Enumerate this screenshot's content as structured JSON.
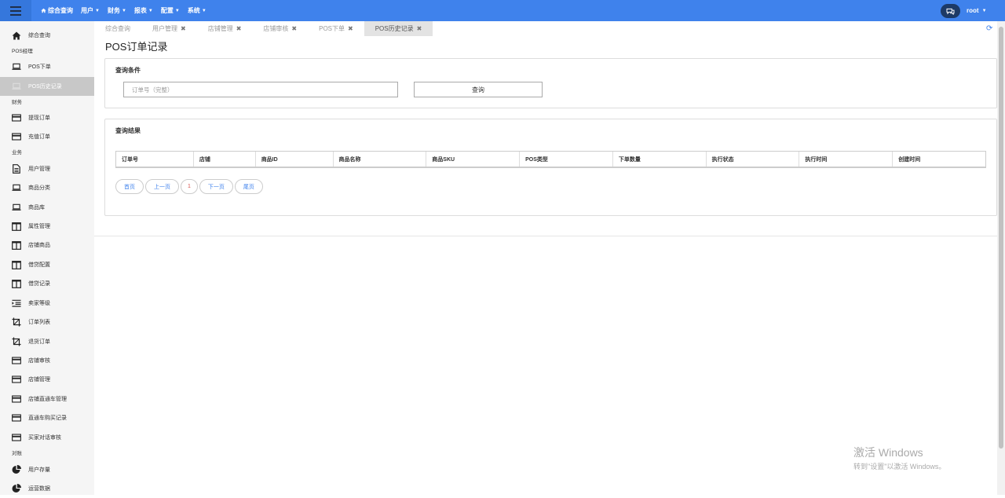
{
  "topbar": {
    "nav": [
      {
        "label": "综合查询",
        "icon": "home-icon"
      },
      {
        "label": "用户",
        "caret": true
      },
      {
        "label": "财务",
        "caret": true
      },
      {
        "label": "报表",
        "caret": true
      },
      {
        "label": "配置",
        "caret": true
      },
      {
        "label": "系统",
        "caret": true
      }
    ],
    "user": "root",
    "accent_color": "#3f82ec"
  },
  "sidebar": {
    "items": [
      {
        "label": "综合查询",
        "icon": "home-icon"
      },
      {
        "label": "POS下单",
        "icon": "laptop-icon"
      },
      {
        "label": "POS历史记录",
        "icon": "laptop-icon",
        "active": true
      },
      {
        "label": "提现订单",
        "icon": "credit-card-icon"
      },
      {
        "label": "充值订单",
        "icon": "credit-card-icon"
      },
      {
        "label": "用户管理",
        "icon": "file-text-icon"
      },
      {
        "label": "商品分类",
        "icon": "laptop-icon"
      },
      {
        "label": "商品库",
        "icon": "laptop-icon"
      },
      {
        "label": "属性管理",
        "icon": "columns-icon"
      },
      {
        "label": "店铺商品",
        "icon": "columns-icon"
      },
      {
        "label": "借贷配置",
        "icon": "columns-icon"
      },
      {
        "label": "借贷记录",
        "icon": "columns-icon"
      },
      {
        "label": "卖家等级",
        "icon": "indent-icon"
      },
      {
        "label": "订单列表",
        "icon": "crop-icon"
      },
      {
        "label": "退货订单",
        "icon": "crop-icon"
      },
      {
        "label": "店铺审核",
        "icon": "credit-card-icon"
      },
      {
        "label": "店铺管理",
        "icon": "credit-card-icon"
      },
      {
        "label": "店铺直通车管理",
        "icon": "credit-card-icon"
      },
      {
        "label": "直通车购买记录",
        "icon": "credit-card-icon"
      },
      {
        "label": "买家对话审核",
        "icon": "credit-card-icon"
      },
      {
        "label": "用户存量",
        "icon": "pie-chart-icon"
      },
      {
        "label": "运营数据",
        "icon": "pie-chart-icon"
      }
    ],
    "sections": [
      "POS经理",
      "财务",
      "业务",
      "对账"
    ]
  },
  "tabs": [
    {
      "label": "综合查询",
      "closable": false
    },
    {
      "label": "用户管理",
      "closable": true
    },
    {
      "label": "店铺管理",
      "closable": true
    },
    {
      "label": "店铺审核",
      "closable": true
    },
    {
      "label": "POS下单",
      "closable": true
    },
    {
      "label": "POS历史记录",
      "closable": true,
      "active": true
    }
  ],
  "page": {
    "title": "POS订单记录",
    "query_panel_title": "查询条件",
    "order_input_placeholder": "订单号（完整）",
    "query_button": "查询",
    "results_panel_title": "查询结果",
    "table_headers": [
      "订单号",
      "店铺",
      "商品ID",
      "商品名称",
      "商品SKU",
      "POS类型",
      "下单数量",
      "执行状态",
      "执行时间",
      "创建时间"
    ],
    "pager": {
      "first": "首页",
      "prev": "上一页",
      "current": "1",
      "next": "下一页",
      "last": "尾页"
    }
  },
  "watermark": {
    "line1": "激活 Windows",
    "line2": "转到\"设置\"以激活 Windows。"
  }
}
